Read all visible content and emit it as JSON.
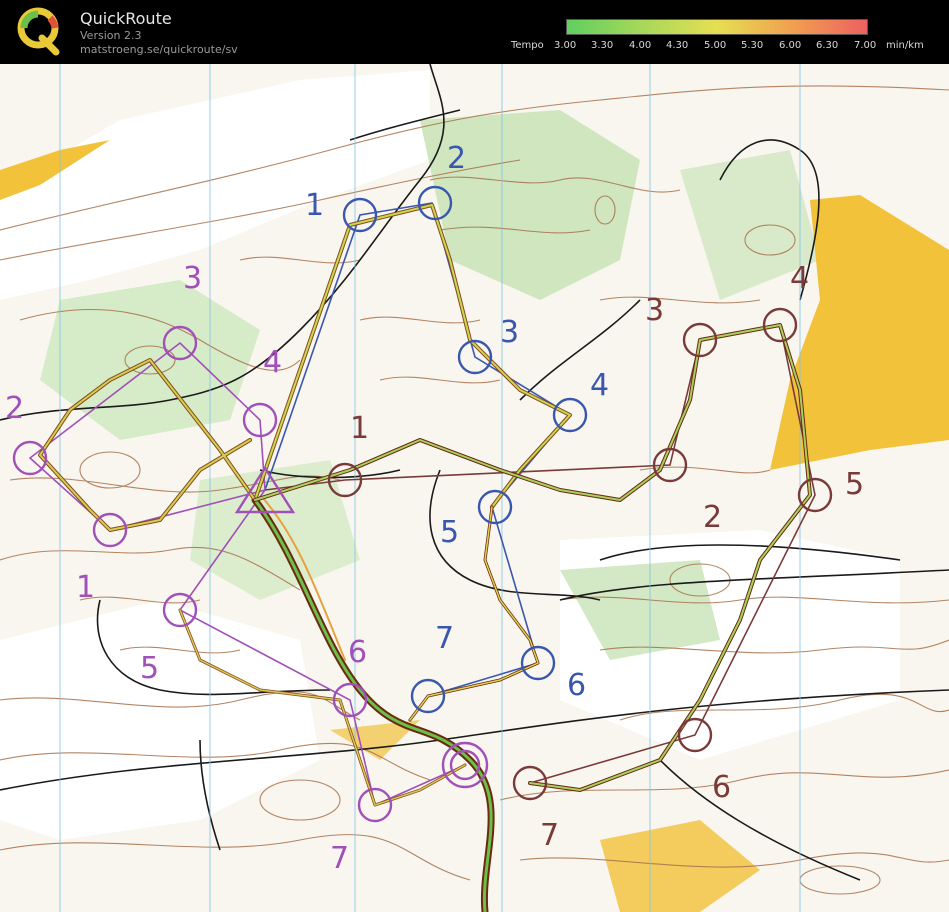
{
  "app": {
    "title": "QuickRoute",
    "version": "Version 2.3",
    "url": "matstroeng.se/quickroute/sv"
  },
  "tempo_scale": {
    "label": "Tempo",
    "ticks": [
      "3.00",
      "3.30",
      "4.00",
      "4.30",
      "5.00",
      "5.30",
      "6.00",
      "6.30",
      "7.00"
    ],
    "unit": "min/km",
    "colors": [
      "#5fcf5f",
      "#a7d85a",
      "#e6df52",
      "#f0a050",
      "#ee6060"
    ]
  },
  "map": {
    "colors": {
      "course_blue": "#3a57b0",
      "course_purple": "#a050b8",
      "course_maroon": "#7a3a3a",
      "contour": "#a8704a",
      "open_land": "#f2c23a",
      "vegetation": "#b8dca4"
    },
    "courses": [
      {
        "color": "blue",
        "controls": [
          {
            "label": "1"
          },
          {
            "label": "2"
          },
          {
            "label": "3"
          },
          {
            "label": "4"
          },
          {
            "label": "5"
          },
          {
            "label": "6"
          },
          {
            "label": "7"
          }
        ]
      },
      {
        "color": "purple",
        "controls": [
          {
            "label": "1"
          },
          {
            "label": "2"
          },
          {
            "label": "3"
          },
          {
            "label": "4"
          },
          {
            "label": "5"
          },
          {
            "label": "6"
          },
          {
            "label": "7"
          }
        ]
      },
      {
        "color": "maroon",
        "controls": [
          {
            "label": "1"
          },
          {
            "label": "2"
          },
          {
            "label": "3"
          },
          {
            "label": "4"
          },
          {
            "label": "5"
          },
          {
            "label": "6"
          },
          {
            "label": "7"
          }
        ]
      }
    ]
  }
}
